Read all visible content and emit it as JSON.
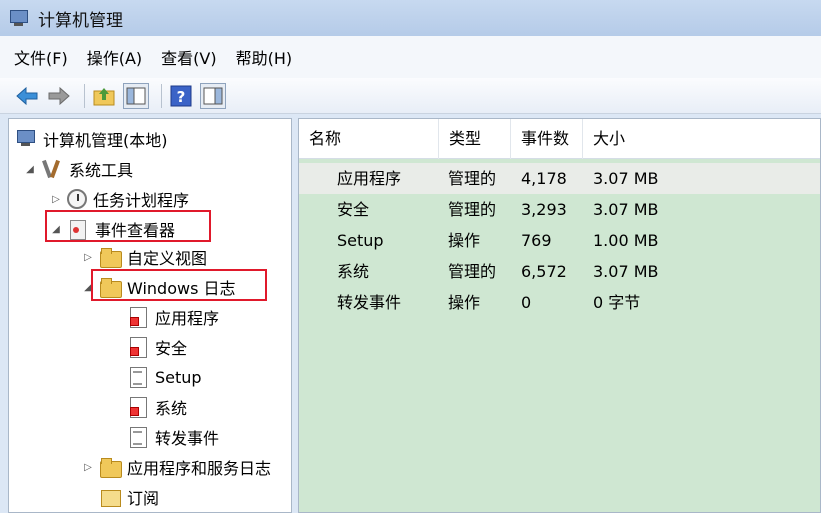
{
  "window": {
    "title": "计算机管理"
  },
  "menu": {
    "items": [
      "文件(F)",
      "操作(A)",
      "查看(V)",
      "帮助(H)"
    ]
  },
  "toolbar": {
    "buttons": [
      "back-arrow-icon",
      "forward-arrow-icon",
      "up-folder-icon",
      "show-hide-tree-icon",
      "help-icon",
      "action-pane-icon"
    ],
    "colors": {
      "back": "#3b8fd8",
      "forward": "#8a8a8a",
      "help": "#3b63c7"
    }
  },
  "tree": {
    "root": "计算机管理(本地)",
    "system_tools": "系统工具",
    "task_scheduler": "任务计划程序",
    "event_viewer": "事件查看器",
    "custom_views": "自定义视图",
    "windows_logs": "Windows 日志",
    "logs": [
      "应用程序",
      "安全",
      "Setup",
      "系统",
      "转发事件"
    ],
    "app_services_logs": "应用程序和服务日志",
    "subscriptions": "订阅"
  },
  "table": {
    "headers": [
      "名称",
      "类型",
      "事件数",
      "大小"
    ],
    "rows": [
      [
        "应用程序",
        "管理的",
        "4,178",
        "3.07 MB"
      ],
      [
        "安全",
        "管理的",
        "3,293",
        "3.07 MB"
      ],
      [
        "Setup",
        "操作",
        "769",
        "1.00 MB"
      ],
      [
        "系统",
        "管理的",
        "6,572",
        "3.07 MB"
      ],
      [
        "转发事件",
        "操作",
        "0",
        "0 字节"
      ]
    ]
  },
  "colors": {
    "highlight_border": "#e0192b",
    "list_background": "#cfe7d2",
    "title_bar": "#b5cbe8"
  }
}
